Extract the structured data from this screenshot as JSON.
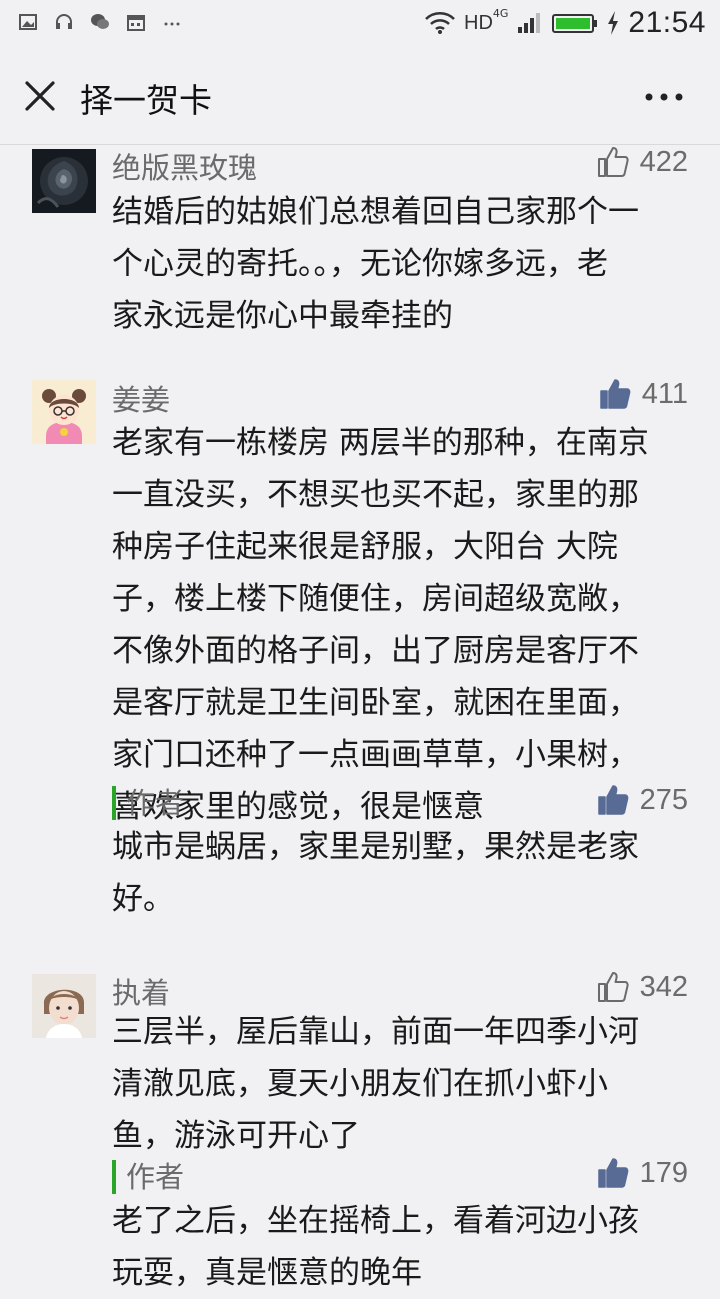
{
  "status_bar": {
    "network": "HD",
    "network_gen": "4G",
    "time": "21:54"
  },
  "nav": {
    "title": "择一贺卡"
  },
  "comments": [
    {
      "username": "绝版黑玫瑰",
      "likes": "422",
      "liked": false,
      "lines": [
        "结婚后的姑娘们总想着回自己家那个一",
        "个心灵的寄托。。，无论你嫁多远，老",
        "家永远是你心中最牵挂的"
      ]
    },
    {
      "username": "姜姜",
      "likes": "411",
      "liked": true,
      "lines": [
        "老家有一栋楼房 两层半的那种，在南京",
        "一直没买，不想买也买不起，家里的那",
        "种房子住起来很是舒服，大阳台 大院",
        "子，楼上楼下随便住，房间超级宽敞，",
        "不像外面的格子间，出了厨房是客厅不",
        "是客厅就是卫生间卧室，就困在里面，",
        "家门口还种了一点画画草草，小果树，",
        "喜欢家里的感觉，很是惬意"
      ],
      "reply": {
        "author_label": "作者",
        "likes": "275",
        "liked": true,
        "lines": [
          "城市是蜗居，家里是别墅，果然是老家",
          "好。"
        ]
      }
    },
    {
      "username": "执着",
      "likes": "342",
      "liked": false,
      "lines": [
        "三层半，屋后靠山，前面一年四季小河",
        "清澈见底，夏天小朋友们在抓小虾小",
        "鱼，游泳可开心了"
      ],
      "reply": {
        "author_label": "作者",
        "likes": "179",
        "liked": true,
        "lines": [
          "老了之后，坐在摇椅上，看着河边小孩",
          "玩耍，真是惬意的晚年"
        ]
      }
    }
  ],
  "colors": {
    "background": "#f1f1f3",
    "author_bar": "#2aa52a",
    "like_active": "#576b95",
    "muted_text": "#6b6b6b"
  }
}
